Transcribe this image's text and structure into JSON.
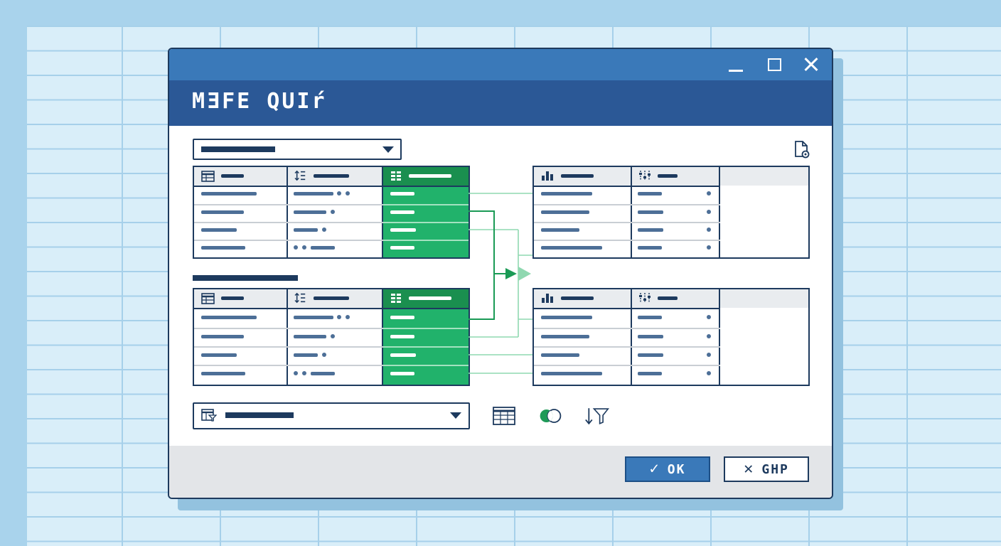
{
  "window": {
    "title": "MƎFE QUIŕ",
    "controls": [
      "minimize-icon",
      "maximize-icon",
      "close-icon"
    ]
  },
  "toolbar": {
    "source_dropdown": {
      "selected": ""
    },
    "join_dropdown": {
      "selected": ""
    },
    "icons": [
      "table-grid-icon",
      "venn-merge-icon",
      "sort-filter-icon"
    ],
    "document_icon": "file-settings-icon"
  },
  "tables": {
    "left_top": {
      "columns": [
        "table-icon",
        "sort-icon",
        "grid-icon"
      ],
      "rows": 4,
      "highlight_column": 2
    },
    "left_bottom": {
      "columns": [
        "table-icon",
        "sort-icon",
        "grid-icon"
      ],
      "rows": 4,
      "highlight_column": 2
    },
    "right_top": {
      "columns": [
        "bar-chart-icon",
        "sliders-icon"
      ],
      "rows": 4
    },
    "right_bottom": {
      "columns": [
        "bar-chart-icon",
        "sliders-icon"
      ],
      "rows": 4
    }
  },
  "footer": {
    "ok_label": "OK",
    "cancel_label": "GHP",
    "ok_icon": "check-icon",
    "cancel_icon": "x-icon"
  },
  "colors": {
    "title_bar": "#3a79b9",
    "header": "#2b5896",
    "accent_green": "#21b26b",
    "border": "#1d3a5e"
  }
}
